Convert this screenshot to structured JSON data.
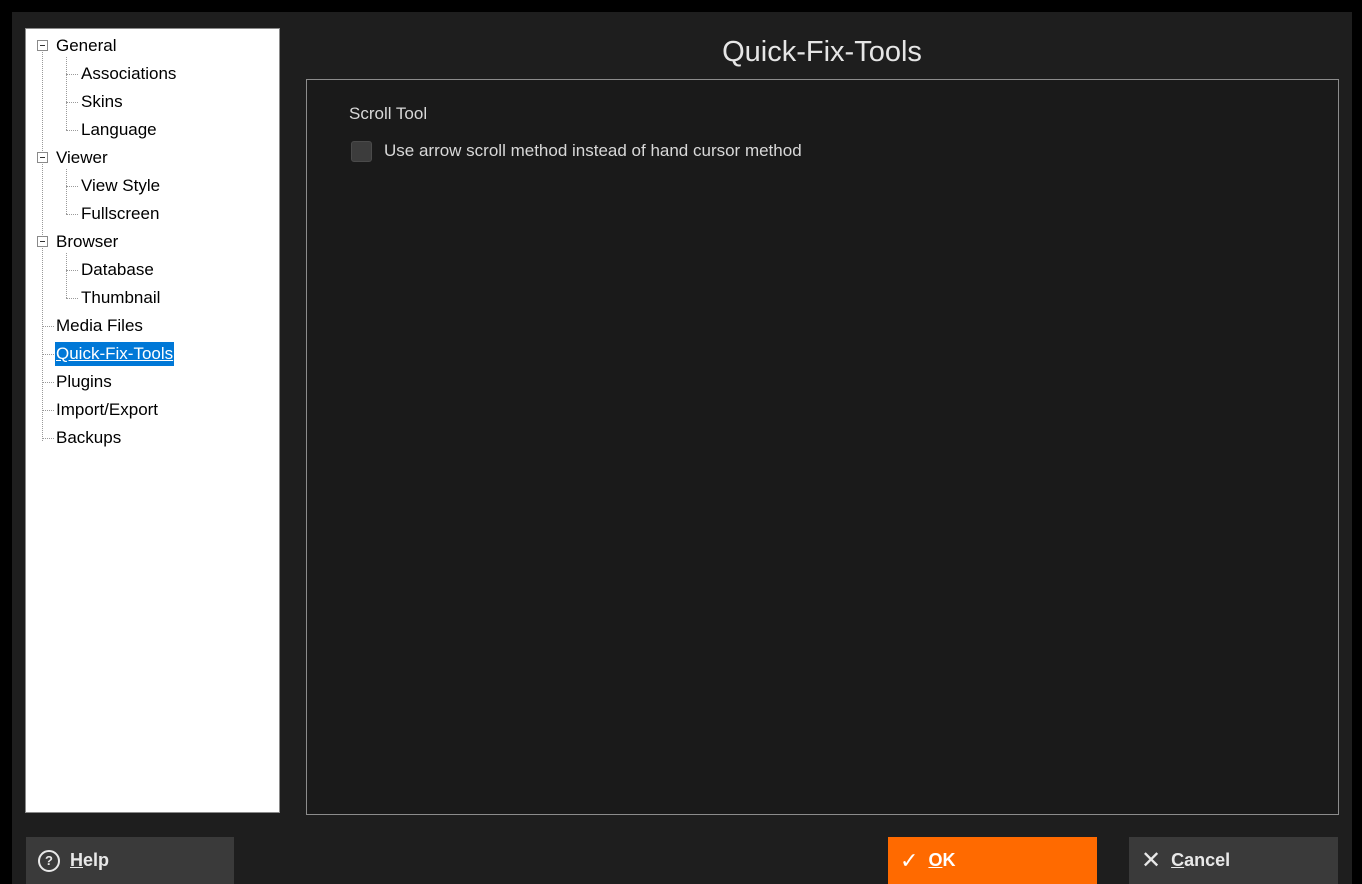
{
  "tree": {
    "items": [
      {
        "label": "General",
        "level": 0,
        "expanded": true
      },
      {
        "label": "Associations",
        "level": 1
      },
      {
        "label": "Skins",
        "level": 1
      },
      {
        "label": "Language",
        "level": 1
      },
      {
        "label": "Viewer",
        "level": 0,
        "expanded": true
      },
      {
        "label": "View Style",
        "level": 1
      },
      {
        "label": "Fullscreen",
        "level": 1
      },
      {
        "label": "Browser",
        "level": 0,
        "expanded": true
      },
      {
        "label": "Database",
        "level": 1
      },
      {
        "label": "Thumbnail",
        "level": 1
      },
      {
        "label": "Media Files",
        "level": 0
      },
      {
        "label": "Quick-Fix-Tools",
        "level": 0,
        "selected": true
      },
      {
        "label": "Plugins",
        "level": 0
      },
      {
        "label": "Import/Export",
        "level": 0
      },
      {
        "label": "Backups",
        "level": 0
      }
    ]
  },
  "panel": {
    "title": "Quick-Fix-Tools",
    "group_label": "Scroll Tool",
    "checkbox_label": "Use arrow scroll method instead of hand cursor method",
    "checkbox_checked": false
  },
  "footer": {
    "help_icon": "help-circle-icon",
    "help_hotkey": "H",
    "help_rest": "elp",
    "ok_icon": "checkmark-icon",
    "ok_hotkey": "O",
    "ok_rest": "K",
    "cancel_icon": "close-icon",
    "cancel_hotkey": "C",
    "cancel_rest": "ancel"
  },
  "colors": {
    "accent": "#ff6a00",
    "selection": "#0078d7",
    "background": "#1e1e1e"
  }
}
